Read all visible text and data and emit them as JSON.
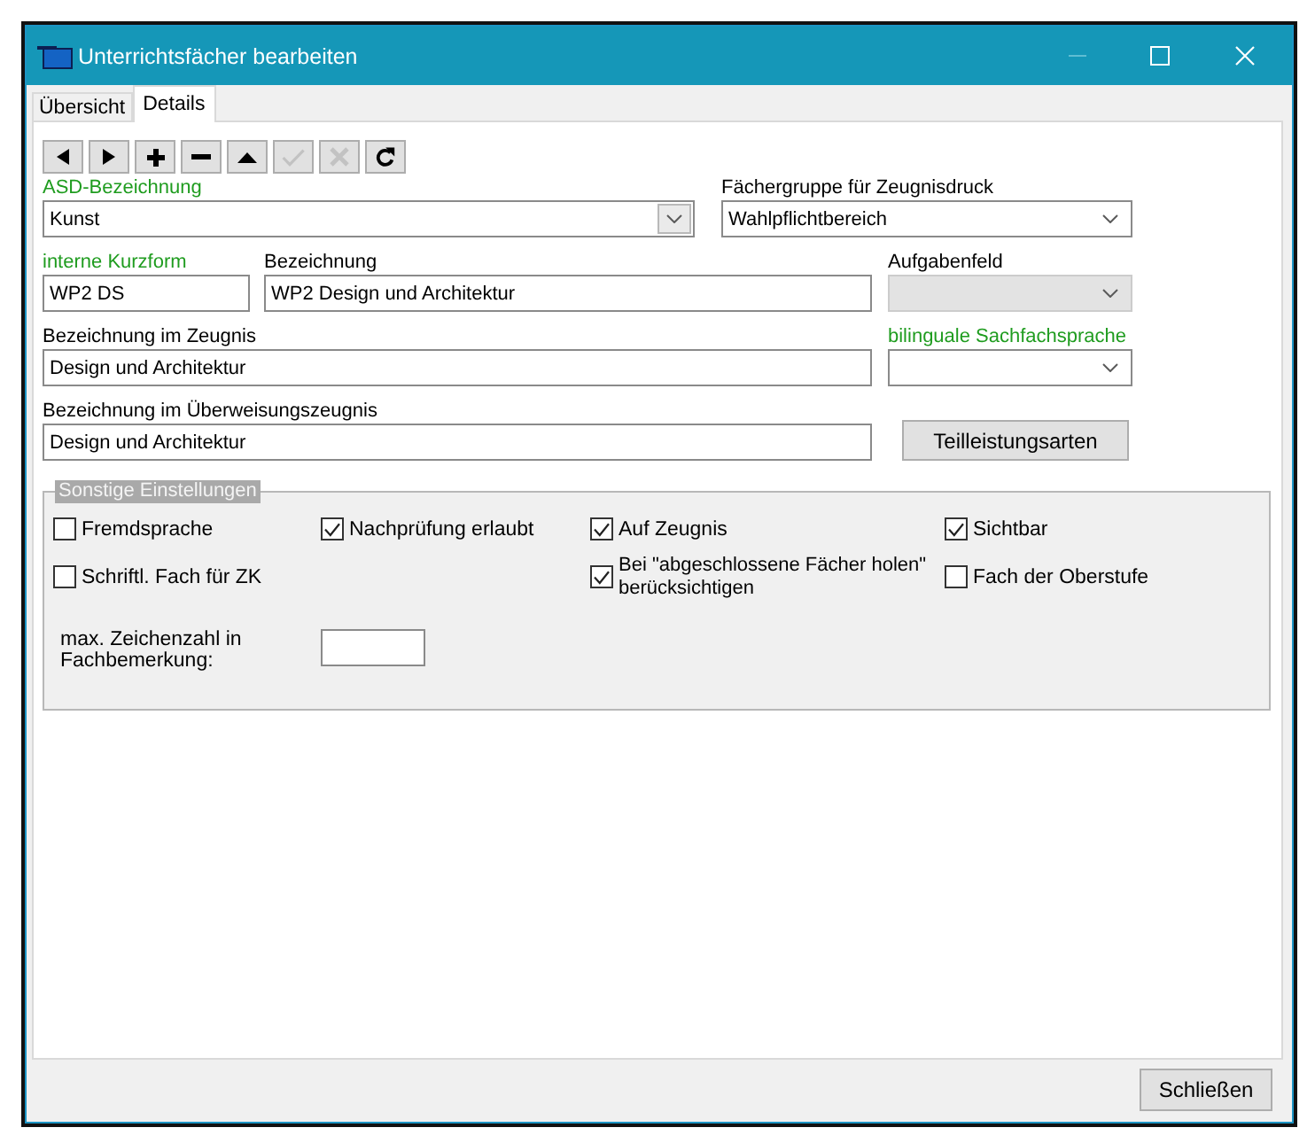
{
  "window": {
    "title": "Unterrichtsfächer bearbeiten",
    "controls": [
      {
        "kind": "minimize",
        "disabled": true
      },
      {
        "kind": "maximize",
        "disabled": false
      },
      {
        "kind": "close",
        "disabled": false
      }
    ]
  },
  "tabs": [
    {
      "label": "Übersicht",
      "selected": false
    },
    {
      "label": "Details",
      "selected": true
    }
  ],
  "toolbar": [
    {
      "kind": "previous",
      "disabled": false
    },
    {
      "kind": "next",
      "disabled": false
    },
    {
      "kind": "add",
      "disabled": false
    },
    {
      "kind": "remove",
      "disabled": false
    },
    {
      "kind": "up",
      "disabled": false
    },
    {
      "kind": "confirm",
      "disabled": true
    },
    {
      "kind": "cancel",
      "disabled": true
    },
    {
      "kind": "refresh",
      "disabled": false
    }
  ],
  "form": {
    "rows": [
      {
        "fields": [
          {
            "kind": "combo_edit",
            "label": "ASD-Bezeichnung",
            "highlighted": true,
            "value": "Kunst",
            "disabled": false
          },
          {
            "kind": "combo",
            "label": "Fächergruppe für Zeugnisdruck",
            "highlighted": false,
            "value": "Wahlpflichtbereich",
            "disabled": false
          }
        ]
      },
      {
        "fields": [
          {
            "kind": "text",
            "label": "interne Kurzform",
            "highlighted": true,
            "value": "WP2 DS",
            "disabled": false
          },
          {
            "kind": "text",
            "label": "Bezeichnung",
            "highlighted": false,
            "value": "WP2 Design und Architektur",
            "disabled": false
          },
          {
            "kind": "combo",
            "label": "Aufgabenfeld",
            "highlighted": false,
            "disabled": true
          }
        ]
      },
      {
        "fields": [
          {
            "kind": "text",
            "label": "Bezeichnung im Zeugnis",
            "highlighted": false,
            "value": "Design und Architektur",
            "disabled": false
          },
          {
            "kind": "combo",
            "label": "bilinguale Sachfachsprache",
            "highlighted": true,
            "disabled": false
          }
        ]
      },
      {
        "fields": [
          {
            "kind": "text",
            "label": "Bezeichnung im Überweisungszeugnis",
            "highlighted": false,
            "value": "Design und Architektur",
            "disabled": false
          },
          {
            "kind": "button",
            "value": "Teilleistungsarten",
            "disabled": false
          }
        ]
      }
    ]
  },
  "settings": {
    "title": "Sonstige Einstellungen",
    "columns": [
      {
        "checkboxes": [
          {
            "label": "Fremdsprache",
            "checked": false
          },
          {
            "label": "Schriftl. Fach für ZK",
            "checked": false
          }
        ]
      },
      {
        "checkboxes": [
          {
            "label": "Nachprüfung erlaubt",
            "checked": true
          }
        ]
      },
      {
        "checkboxes": [
          {
            "label": "Auf Zeugnis",
            "checked": true
          },
          {
            "label": "Bei \"abgeschlossene Fächer holen\" berücksichtigen",
            "checked": true
          }
        ]
      },
      {
        "checkboxes": [
          {
            "label": "Sichtbar",
            "checked": true
          },
          {
            "label": "Fach der Oberstufe",
            "checked": false
          }
        ]
      }
    ],
    "max_chars": {
      "label": "max. Zeichenzahl in Fachbemerkung:"
    }
  },
  "footer": {
    "close_button": "Schließen"
  }
}
